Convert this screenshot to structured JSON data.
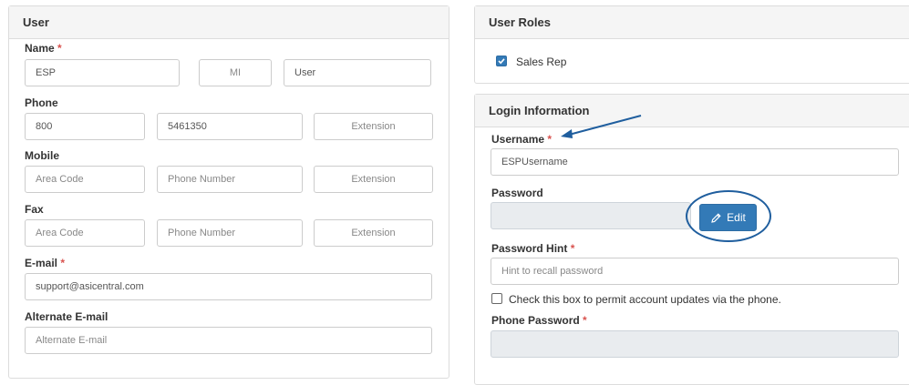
{
  "user": {
    "title": "User",
    "name_label": "Name",
    "name_first": "ESP",
    "name_mi_placeholder": "MI",
    "name_last": "User",
    "phone_label": "Phone",
    "phone_area": "800",
    "phone_number": "5461350",
    "phone_ext_placeholder": "Extension",
    "mobile_label": "Mobile",
    "mobile_area_placeholder": "Area Code",
    "mobile_number_placeholder": "Phone Number",
    "mobile_ext_placeholder": "Extension",
    "fax_label": "Fax",
    "fax_area_placeholder": "Area Code",
    "fax_number_placeholder": "Phone Number",
    "fax_ext_placeholder": "Extension",
    "email_label": "E-mail",
    "email_value": "support@asicentral.com",
    "alt_email_label": "Alternate E-mail",
    "alt_email_placeholder": "Alternate E-mail",
    "required_marker": "*"
  },
  "roles": {
    "title": "User Roles",
    "sales_rep_label": "Sales Rep",
    "sales_rep_checked": true
  },
  "login": {
    "title": "Login Information",
    "username_label": "Username",
    "username_value": "ESPUsername",
    "password_label": "Password",
    "edit_label": "Edit",
    "hint_label": "Password Hint",
    "hint_placeholder": "Hint to recall password",
    "phone_updates_label": "Check this box to permit account updates via the phone.",
    "phone_updates_checked": false,
    "phone_password_label": "Phone Password"
  },
  "colors": {
    "accent": "#337ab7",
    "annotation": "#1f5e9e",
    "required": "#d9534f"
  }
}
